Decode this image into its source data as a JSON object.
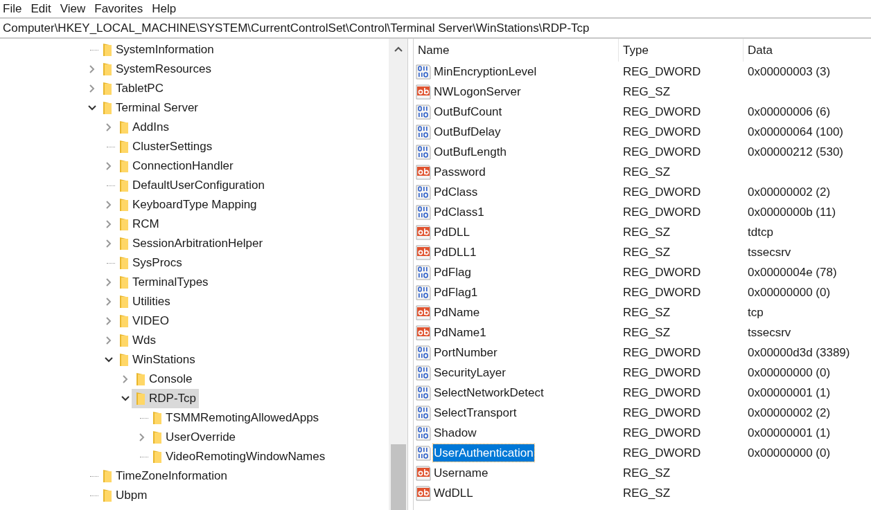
{
  "menu": [
    "File",
    "Edit",
    "View",
    "Favorites",
    "Help"
  ],
  "address": "Computer\\HKEY_LOCAL_MACHINE\\SYSTEM\\CurrentControlSet\\Control\\Terminal Server\\WinStations\\RDP-Tcp",
  "tree": [
    {
      "name": "SystemInformation",
      "selected": false
    },
    {
      "name": "SystemResources",
      "expanded": false,
      "selected": false
    },
    {
      "name": "TabletPC",
      "expanded": false,
      "selected": false
    },
    {
      "name": "Terminal Server",
      "expanded": true,
      "selected": false,
      "children": [
        {
          "name": "AddIns",
          "expanded": false,
          "selected": false
        },
        {
          "name": "ClusterSettings",
          "selected": false
        },
        {
          "name": "ConnectionHandler",
          "expanded": false,
          "selected": false
        },
        {
          "name": "DefaultUserConfiguration",
          "selected": false
        },
        {
          "name": "KeyboardType Mapping",
          "expanded": false,
          "selected": false
        },
        {
          "name": "RCM",
          "expanded": false,
          "selected": false
        },
        {
          "name": "SessionArbitrationHelper",
          "expanded": false,
          "selected": false
        },
        {
          "name": "SysProcs",
          "selected": false
        },
        {
          "name": "TerminalTypes",
          "expanded": false,
          "selected": false
        },
        {
          "name": "Utilities",
          "expanded": false,
          "selected": false
        },
        {
          "name": "VIDEO",
          "expanded": false,
          "selected": false
        },
        {
          "name": "Wds",
          "expanded": false,
          "selected": false
        },
        {
          "name": "WinStations",
          "expanded": true,
          "selected": false,
          "children": [
            {
              "name": "Console",
              "expanded": false,
              "selected": false
            },
            {
              "name": "RDP-Tcp",
              "expanded": true,
              "selected": true,
              "children": [
                {
                  "name": "TSMMRemotingAllowedApps",
                  "selected": false
                },
                {
                  "name": "UserOverride",
                  "expanded": false,
                  "selected": false
                },
                {
                  "name": "VideoRemotingWindowNames",
                  "selected": false
                }
              ]
            }
          ]
        }
      ]
    },
    {
      "name": "TimeZoneInformation",
      "selected": false
    },
    {
      "name": "Ubpm",
      "selected": false
    }
  ],
  "columns": [
    "Name",
    "Type",
    "Data"
  ],
  "rows": [
    {
      "kind": "dword",
      "name": "MinEncryptionLevel",
      "type": "REG_DWORD",
      "data": "0x00000003 (3)",
      "selected": false
    },
    {
      "kind": "sz",
      "name": "NWLogonServer",
      "type": "REG_SZ",
      "selected": false
    },
    {
      "kind": "dword",
      "name": "OutBufCount",
      "type": "REG_DWORD",
      "data": "0x00000006 (6)",
      "selected": false
    },
    {
      "kind": "dword",
      "name": "OutBufDelay",
      "type": "REG_DWORD",
      "data": "0x00000064 (100)",
      "selected": false
    },
    {
      "kind": "dword",
      "name": "OutBufLength",
      "type": "REG_DWORD",
      "data": "0x00000212 (530)",
      "selected": false
    },
    {
      "kind": "sz",
      "name": "Password",
      "type": "REG_SZ",
      "selected": false
    },
    {
      "kind": "dword",
      "name": "PdClass",
      "type": "REG_DWORD",
      "data": "0x00000002 (2)",
      "selected": false
    },
    {
      "kind": "dword",
      "name": "PdClass1",
      "type": "REG_DWORD",
      "data": "0x0000000b (11)",
      "selected": false
    },
    {
      "kind": "sz",
      "name": "PdDLL",
      "type": "REG_SZ",
      "data": "tdtcp",
      "selected": false
    },
    {
      "kind": "sz",
      "name": "PdDLL1",
      "type": "REG_SZ",
      "data": "tssecsrv",
      "selected": false
    },
    {
      "kind": "dword",
      "name": "PdFlag",
      "type": "REG_DWORD",
      "data": "0x0000004e (78)",
      "selected": false
    },
    {
      "kind": "dword",
      "name": "PdFlag1",
      "type": "REG_DWORD",
      "data": "0x00000000 (0)",
      "selected": false
    },
    {
      "kind": "sz",
      "name": "PdName",
      "type": "REG_SZ",
      "data": "tcp",
      "selected": false
    },
    {
      "kind": "sz",
      "name": "PdName1",
      "type": "REG_SZ",
      "data": "tssecsrv",
      "selected": false
    },
    {
      "kind": "dword",
      "name": "PortNumber",
      "type": "REG_DWORD",
      "data": "0x00000d3d (3389)",
      "selected": false
    },
    {
      "kind": "dword",
      "name": "SecurityLayer",
      "type": "REG_DWORD",
      "data": "0x00000000 (0)",
      "selected": false
    },
    {
      "kind": "dword",
      "name": "SelectNetworkDetect",
      "type": "REG_DWORD",
      "data": "0x00000001 (1)",
      "selected": false
    },
    {
      "kind": "dword",
      "name": "SelectTransport",
      "type": "REG_DWORD",
      "data": "0x00000002 (2)",
      "selected": false
    },
    {
      "kind": "dword",
      "name": "Shadow",
      "type": "REG_DWORD",
      "data": "0x00000001 (1)",
      "selected": false
    },
    {
      "kind": "dword",
      "name": "UserAuthentication",
      "type": "REG_DWORD",
      "data": "0x00000000 (0)",
      "selected": true
    },
    {
      "kind": "sz",
      "name": "Username",
      "type": "REG_SZ",
      "selected": false
    },
    {
      "kind": "sz",
      "name": "WdDLL",
      "type": "REG_SZ",
      "selected": false
    }
  ]
}
